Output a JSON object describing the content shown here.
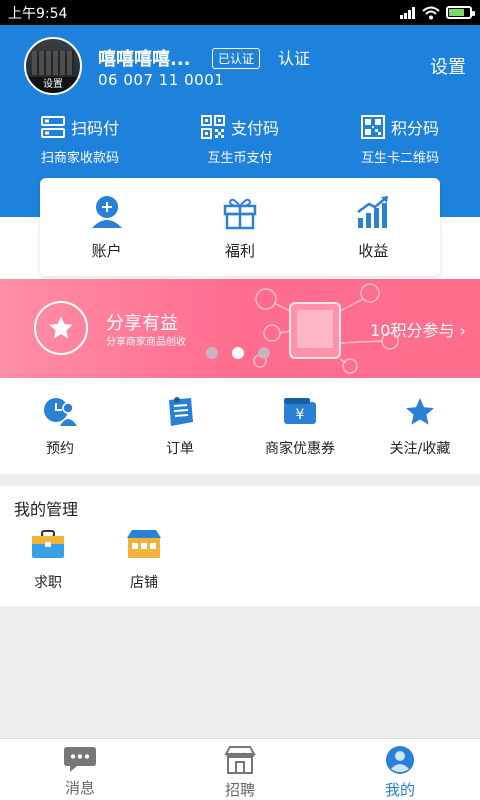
{
  "status_bar": {
    "time": "上午9:54"
  },
  "profile": {
    "avatar_caption": "设置",
    "nickname": "嘻嘻嘻嘻...",
    "verified_badge": "已认证",
    "verify_link": "认证",
    "account_number": "06 007 11 0001",
    "settings_label": "设置"
  },
  "quick_actions": [
    {
      "label": "扫码付",
      "sub": "扫商家收款码",
      "icon": "scan-pay-icon"
    },
    {
      "label": "支付码",
      "sub": "互生币支付",
      "icon": "pay-code-icon"
    },
    {
      "label": "积分码",
      "sub": "互生卡二维码",
      "icon": "points-qr-icon"
    }
  ],
  "card": [
    {
      "label": "账户",
      "icon": "account-icon"
    },
    {
      "label": "福利",
      "icon": "gift-icon"
    },
    {
      "label": "收益",
      "icon": "growth-chart-icon"
    }
  ],
  "banner": {
    "title": "分享有益",
    "subtitle": "分享商家商品创收",
    "cta": "10积分参与",
    "page_index": 2,
    "page_count": 3
  },
  "grid": [
    {
      "label": "预约",
      "icon": "appointment-icon"
    },
    {
      "label": "订单",
      "icon": "order-icon"
    },
    {
      "label": "商家优惠券",
      "icon": "coupon-icon"
    },
    {
      "label": "关注/收藏",
      "icon": "star-icon"
    }
  ],
  "management": {
    "title": "我的管理",
    "items": [
      {
        "label": "求职",
        "icon": "briefcase-icon"
      },
      {
        "label": "店铺",
        "icon": "shop-icon"
      }
    ]
  },
  "tabs": [
    {
      "label": "消息",
      "icon": "message-icon",
      "active": false
    },
    {
      "label": "招聘",
      "icon": "recruit-icon",
      "active": false
    },
    {
      "label": "我的",
      "icon": "me-icon",
      "active": true
    }
  ],
  "colors": {
    "primary": "#1e82dc",
    "banner": "#ff6d8e",
    "background": "#efefef"
  }
}
